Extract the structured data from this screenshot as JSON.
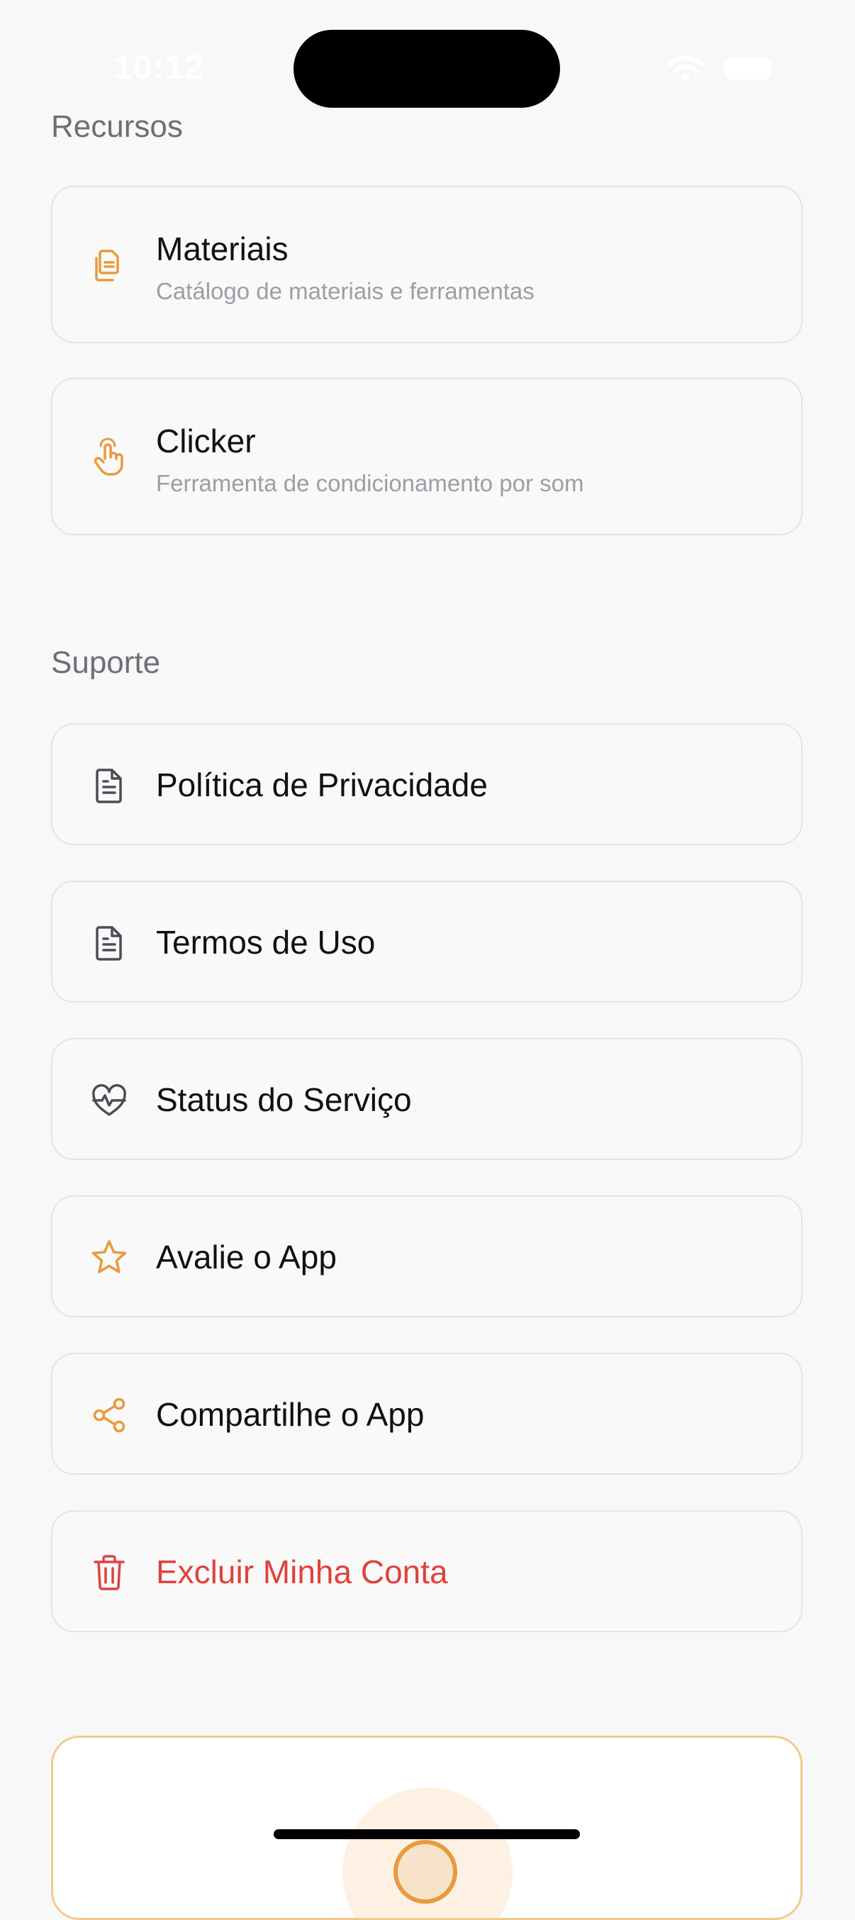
{
  "status_bar": {
    "time": "10:12"
  },
  "recursos": {
    "title": "Recursos",
    "items": [
      {
        "title": "Materiais",
        "subtitle": "Catálogo de materiais e ferramentas",
        "icon": "documents-icon"
      },
      {
        "title": "Clicker",
        "subtitle": "Ferramenta de condicionamento por som",
        "icon": "hand-pointer-icon"
      }
    ]
  },
  "suporte": {
    "title": "Suporte",
    "items": [
      {
        "title": "Política de Privacidade",
        "icon": "document-icon"
      },
      {
        "title": "Termos de Uso",
        "icon": "document-icon"
      },
      {
        "title": "Status do Serviço",
        "icon": "heart-pulse-icon"
      },
      {
        "title": "Avalie o App",
        "icon": "star-icon"
      },
      {
        "title": "Compartilhe o App",
        "icon": "share-icon"
      },
      {
        "title": "Excluir Minha Conta",
        "icon": "trash-icon"
      }
    ]
  },
  "colors": {
    "accent": "#e89a3d",
    "danger": "#e0413f",
    "neutral_icon": "#4a4d55"
  }
}
